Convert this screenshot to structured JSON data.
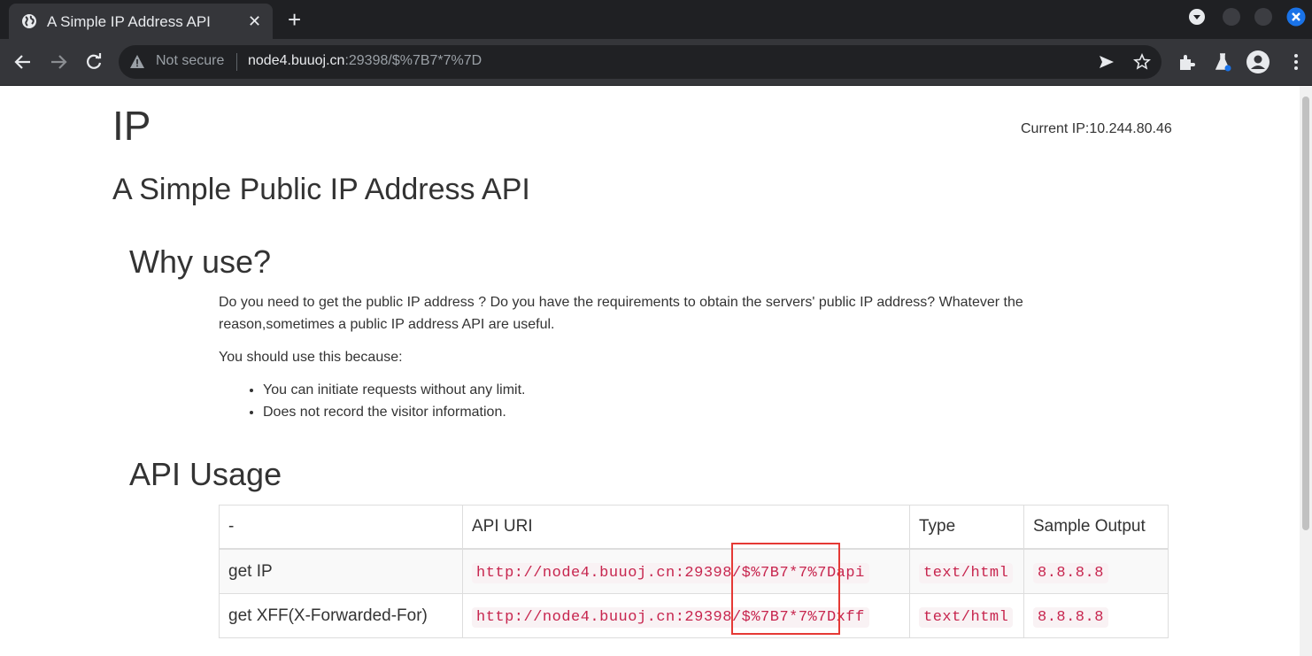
{
  "browser": {
    "tab_title": "A Simple IP Address API",
    "tab_close": "✕",
    "new_tab": "+",
    "security_label": "Not secure",
    "url_host": "node4.buuoj.cn",
    "url_rest": ":29398/$%7B7*7%7D",
    "colors": {
      "chrome_dark": "#1f2023",
      "chrome": "#35363a",
      "omnibox": "#202124",
      "close_blue": "#1a73e8"
    }
  },
  "page": {
    "logo": "IP",
    "current_ip": "Current IP:10.244.80.46",
    "subtitle": "A Simple Public IP Address API",
    "why_heading": "Why use?",
    "why_para1": "Do you need to get the public IP address ? Do you have the requirements to obtain the servers' public IP address? Whatever the reason,sometimes a public IP address API are useful.",
    "why_para2": "You should use this because:",
    "bullets": [
      "You can initiate requests without any limit.",
      "Does not record the visitor information."
    ],
    "api_heading": "API Usage",
    "table": {
      "headers": [
        "-",
        "API URI",
        "Type",
        "Sample Output"
      ],
      "rows": [
        {
          "name": "get IP",
          "uri": "http://node4.buuoj.cn:29398/$%7B7*7%7Dapi",
          "type": "text/html",
          "output": "8.8.8.8"
        },
        {
          "name": "get XFF(X-Forwarded-For)",
          "uri": "http://node4.buuoj.cn:29398/$%7B7*7%7Dxff",
          "type": "text/html",
          "output": "8.8.8.8"
        }
      ]
    },
    "colors": {
      "code_text": "#c7254e",
      "code_bg": "#f9f2f4",
      "annotation_box": "#e53935"
    }
  }
}
